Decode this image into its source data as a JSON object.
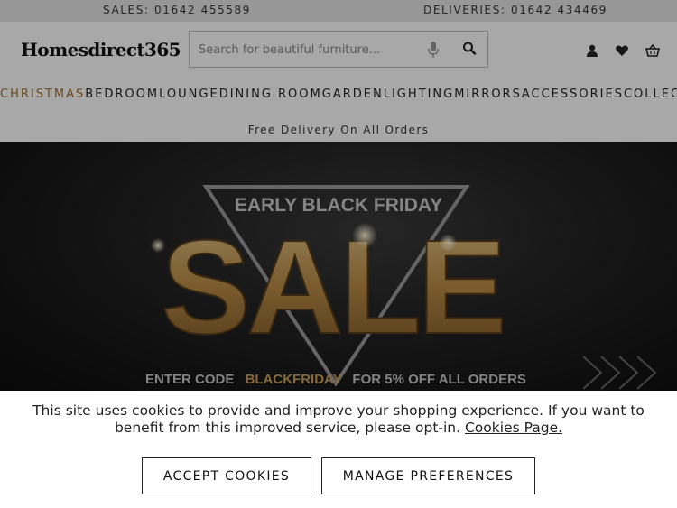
{
  "topbar": {
    "sales": "SALES: 01642 455589",
    "deliveries": "DELIVERIES: 01642 434469"
  },
  "header": {
    "logo": "Homesdirect365",
    "search_placeholder": "Search for beautiful furniture...",
    "icons": [
      "user-icon",
      "heart-icon",
      "basket-icon"
    ]
  },
  "nav": {
    "items": [
      {
        "label": "CHRISTMAS"
      },
      {
        "label": "BEDROOM"
      },
      {
        "label": "LOUNGE"
      },
      {
        "label": "DINING ROOM"
      },
      {
        "label": "GARDEN"
      },
      {
        "label": "LIGHTING"
      },
      {
        "label": "MIRRORS"
      },
      {
        "label": "ACCESSORIES"
      },
      {
        "label": "COLLECTIONS"
      }
    ],
    "highlight_color": "#a4722c"
  },
  "delivery_banner": "Free Delivery On All Orders",
  "hero": {
    "heading": "EARLY BLACK FRIDAY",
    "big": "SALE",
    "line_pre": "ENTER CODE",
    "code": "BLACKFRIDAY",
    "line_post": "FOR 5% OFF ALL ORDERS",
    "gold": "#c9a15b"
  },
  "cookie": {
    "message": "This site uses cookies to provide and improve your shopping experience. If you want to benefit from this improved service, please opt-in.",
    "link": "Cookies Page.",
    "accept": "ACCEPT COOKIES",
    "manage": "MANAGE PREFERENCES"
  }
}
